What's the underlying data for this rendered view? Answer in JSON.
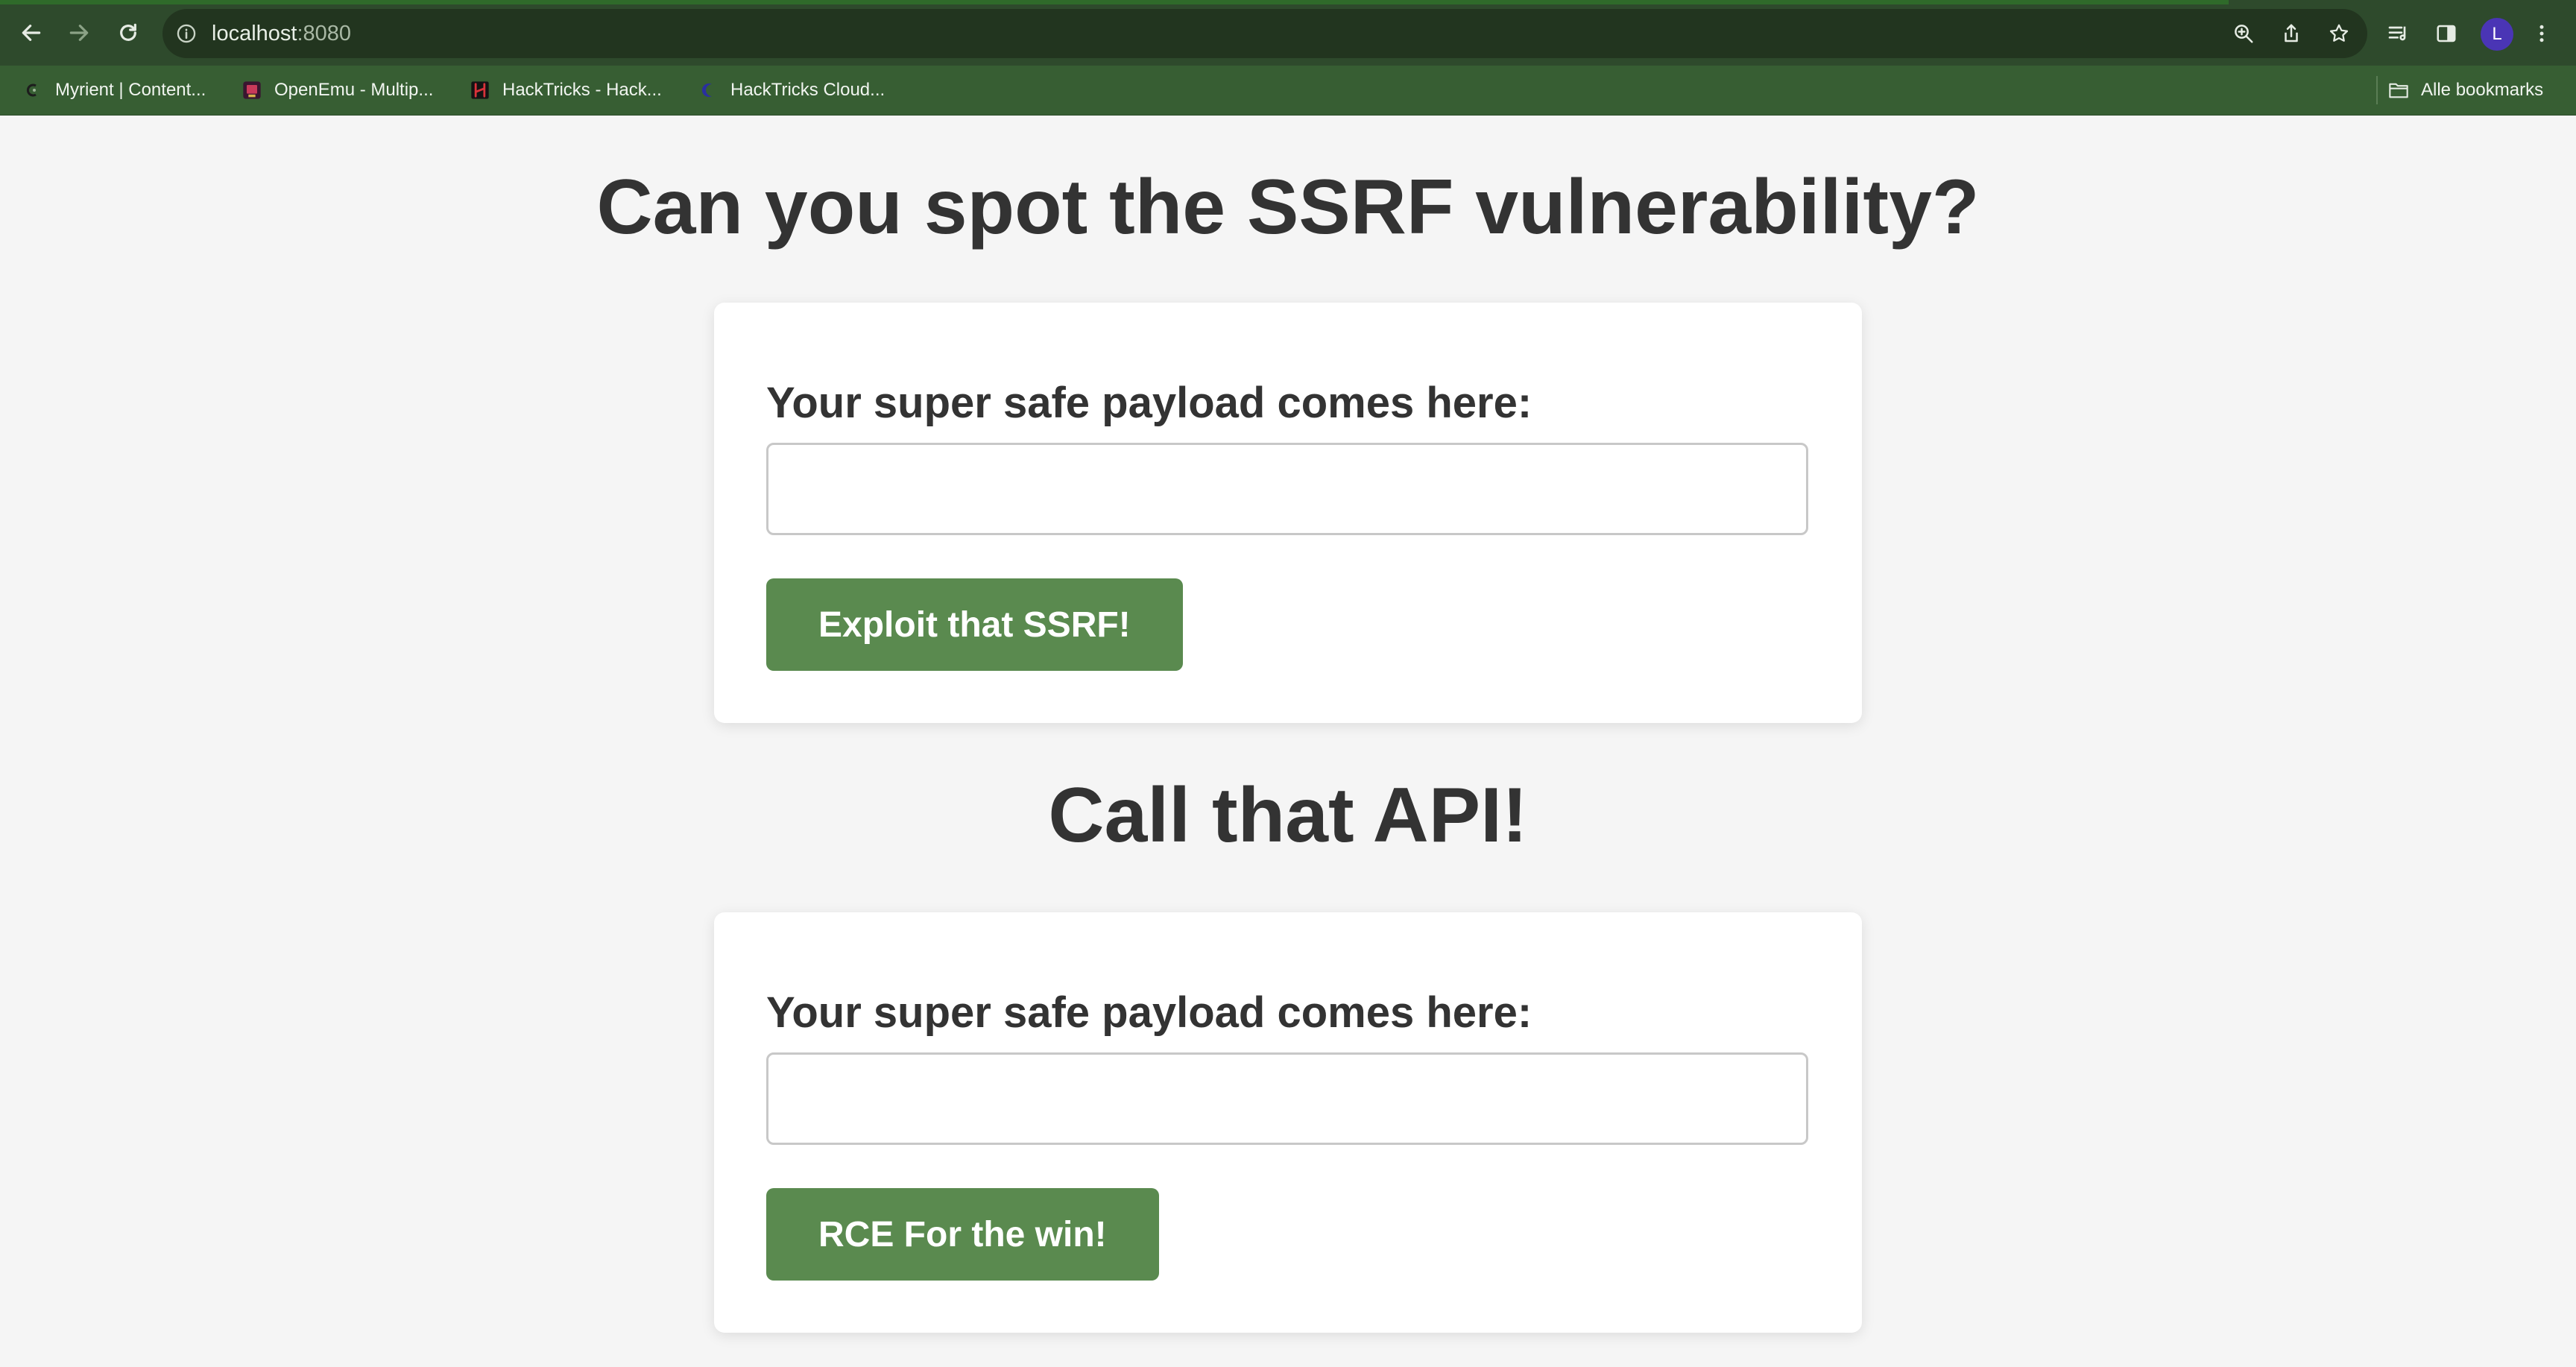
{
  "browser": {
    "url_host": "localhost",
    "url_port": ":8080",
    "avatar_initial": "L",
    "bookmarks": [
      {
        "label": "Myrient | Content..."
      },
      {
        "label": "OpenEmu - Multip..."
      },
      {
        "label": "HackTricks - Hack..."
      },
      {
        "label": "HackTricks Cloud..."
      }
    ],
    "all_bookmarks_label": "Alle bookmarks"
  },
  "page": {
    "title": "Can you spot the SSRF vulnerability?",
    "forms": [
      {
        "label": "Your super safe payload comes here:",
        "input_value": "",
        "button_label": "Exploit that SSRF!"
      },
      {
        "label": "Your super safe payload comes here:",
        "input_value": "",
        "button_label": "RCE For the win!"
      }
    ],
    "section_title": "Call that API!"
  },
  "colors": {
    "toolbar": "#2e4a2c",
    "bookmarks_bar": "#375e33",
    "button": "#5a8a4f",
    "heading": "#333333",
    "page_bg": "#f5f5f5"
  }
}
